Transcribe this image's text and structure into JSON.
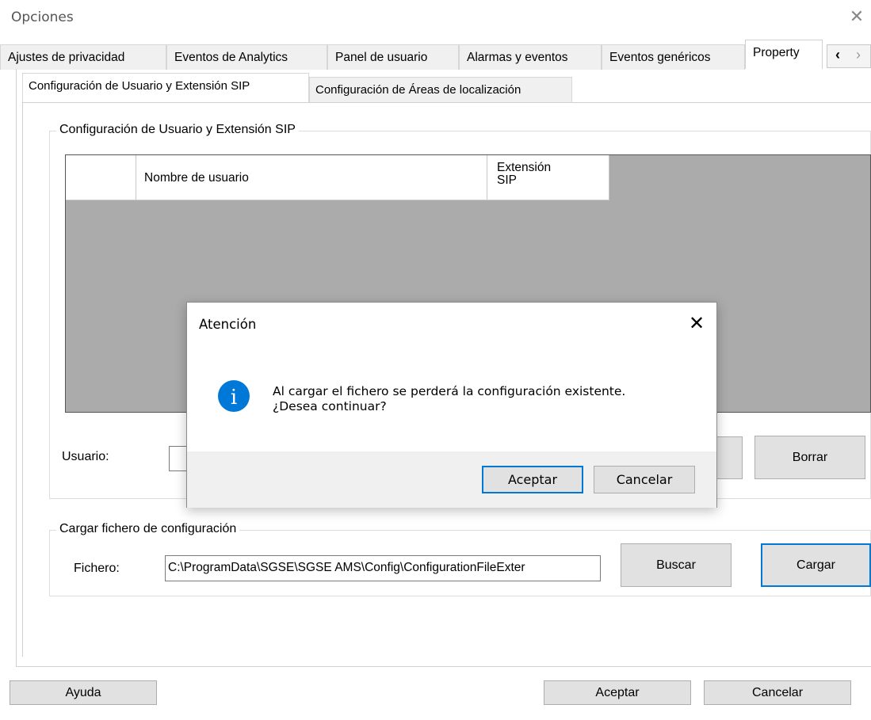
{
  "window": {
    "title": "Opciones",
    "close_glyph": "✕"
  },
  "tabs": [
    {
      "label": "Ajustes de privacidad"
    },
    {
      "label": "Eventos de Analytics"
    },
    {
      "label": "Panel de usuario"
    },
    {
      "label": "Alarmas y eventos"
    },
    {
      "label": "Eventos genéricos"
    },
    {
      "label": "Property"
    }
  ],
  "tab_scroll": {
    "left": "‹",
    "right": "›"
  },
  "subtabs": [
    {
      "label": "Configuración de Usuario y Extensión SIP"
    },
    {
      "label": "Configuración de Áreas de localización"
    }
  ],
  "user_group": {
    "title": "Configuración de Usuario y Extensión SIP",
    "columns": [
      "",
      "Nombre de usuario",
      "Extensión\nSIP"
    ],
    "usuario_label": "Usuario:",
    "usuario_value": "",
    "delete_label": "Borrar"
  },
  "file_group": {
    "title": "Cargar fichero de configuración",
    "file_label": "Fichero:",
    "file_value": "C:\\ProgramData\\SGSE\\SGSE AMS\\Config\\ConfigurationFileExter",
    "browse_label": "Buscar",
    "load_label": "Cargar"
  },
  "footer": {
    "help_label": "Ayuda",
    "ok_label": "Aceptar",
    "cancel_label": "Cancelar"
  },
  "modal": {
    "title": "Atención",
    "close_glyph": "✕",
    "icon_letter": "i",
    "message_line1": "Al cargar el fichero se perderá la configuración existente.",
    "message_line2": "¿Desea continuar?",
    "ok_label": "Aceptar",
    "cancel_label": "Cancelar"
  },
  "colors": {
    "accent": "#0078d7",
    "grid_bg": "#ababab",
    "footer_bg": "#f0f0f0"
  }
}
